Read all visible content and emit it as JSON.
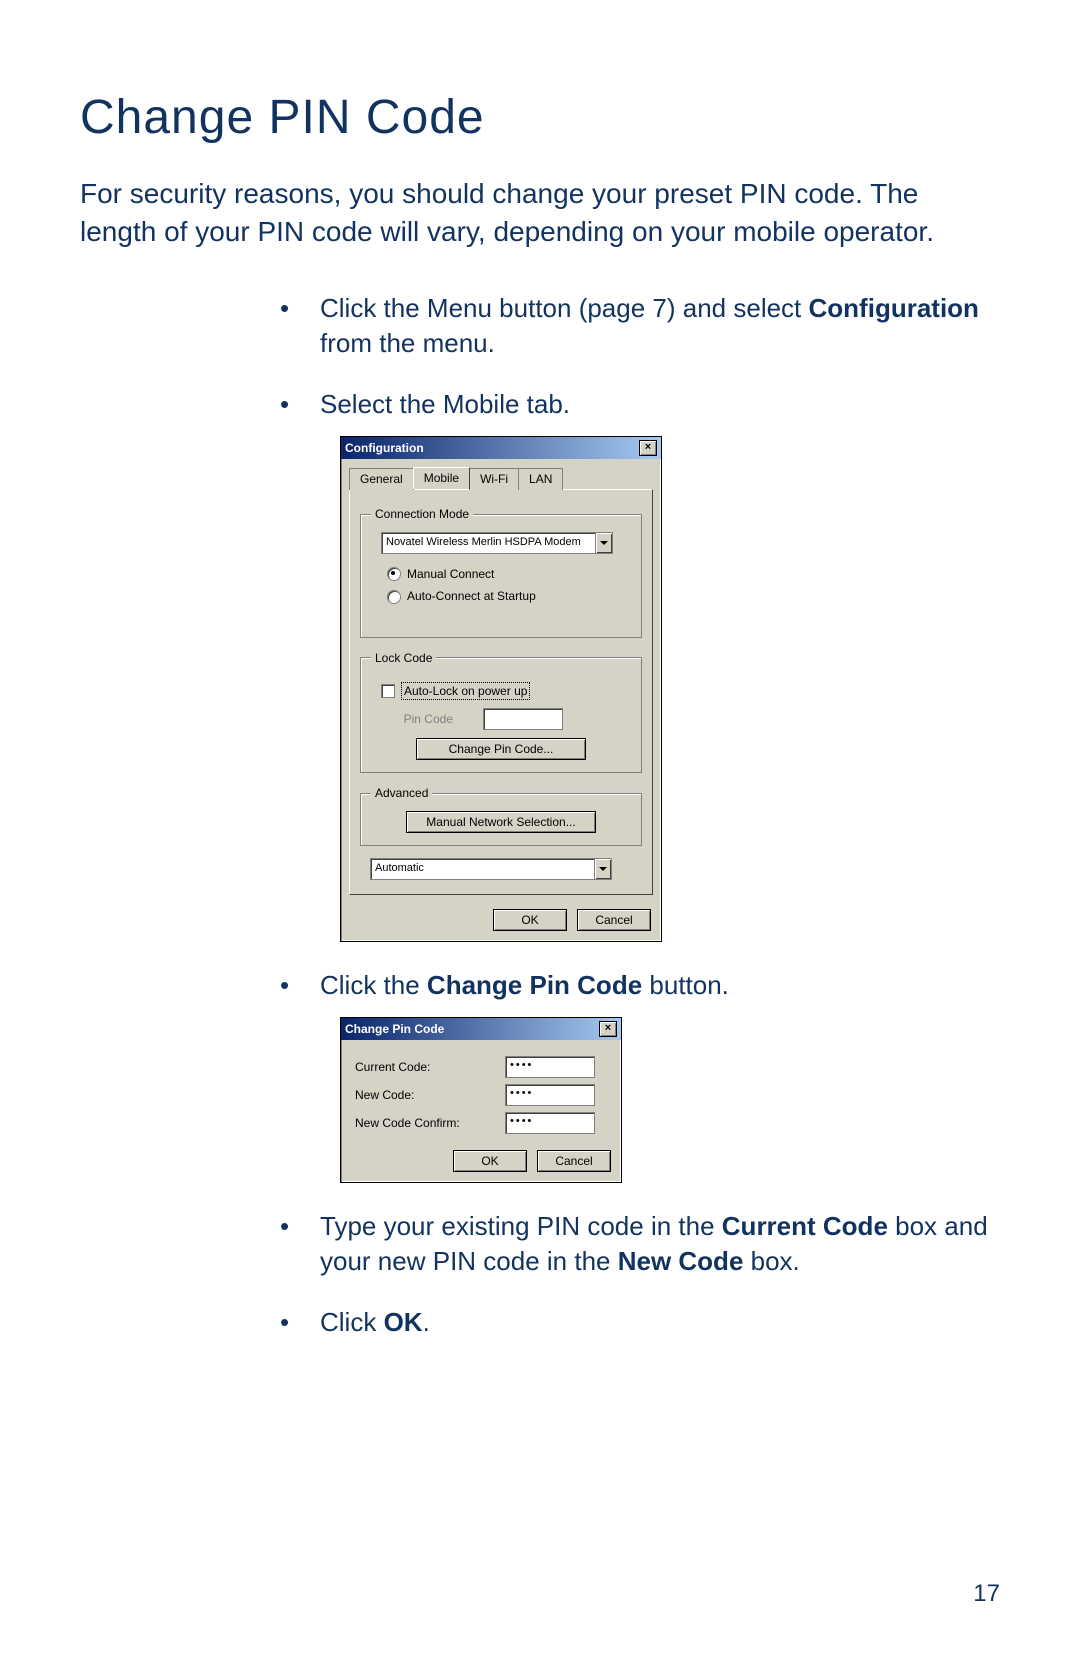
{
  "page": {
    "title": "Change PIN Code",
    "intro": "For security reasons, you should change your preset PIN code. The length of your PIN code will vary, depending on your mobile operator.",
    "number": "17"
  },
  "steps": {
    "s1_a": "Click the Menu button (page 7) and select ",
    "s1_b": "Configuration",
    "s1_c": " from the menu.",
    "s2": "Select the Mobile tab.",
    "s3_a": "Click the ",
    "s3_b": "Change Pin Code",
    "s3_c": " button.",
    "s4_a": "Type your existing PIN code in the ",
    "s4_b": "Current Code",
    "s4_c": " box and your new PIN code in the ",
    "s4_d": "New Code",
    "s4_e": " box.",
    "s5_a": "Click ",
    "s5_b": "OK",
    "s5_c": "."
  },
  "config_dialog": {
    "title": "Configuration",
    "tabs": {
      "general": "General",
      "mobile": "Mobile",
      "wifi": "Wi-Fi",
      "lan": "LAN"
    },
    "groups": {
      "conn_mode": "Connection Mode",
      "lock_code": "Lock Code",
      "advanced": "Advanced"
    },
    "modem_value": "Novatel Wireless Merlin HSDPA Modem",
    "manual_connect": "Manual Connect",
    "auto_connect": "Auto-Connect at Startup",
    "auto_lock": "Auto-Lock on power up",
    "pin_code_label": "Pin Code",
    "change_pin_btn": "Change Pin Code...",
    "manual_net_btn": "Manual Network Selection...",
    "auto_value": "Automatic",
    "ok": "OK",
    "cancel": "Cancel"
  },
  "cpin_dialog": {
    "title": "Change Pin Code",
    "current": "Current Code:",
    "new": "New Code:",
    "confirm": "New Code Confirm:",
    "mask1": "••••",
    "mask2": "••••",
    "mask3": "••••",
    "ok": "OK",
    "cancel": "Cancel"
  }
}
